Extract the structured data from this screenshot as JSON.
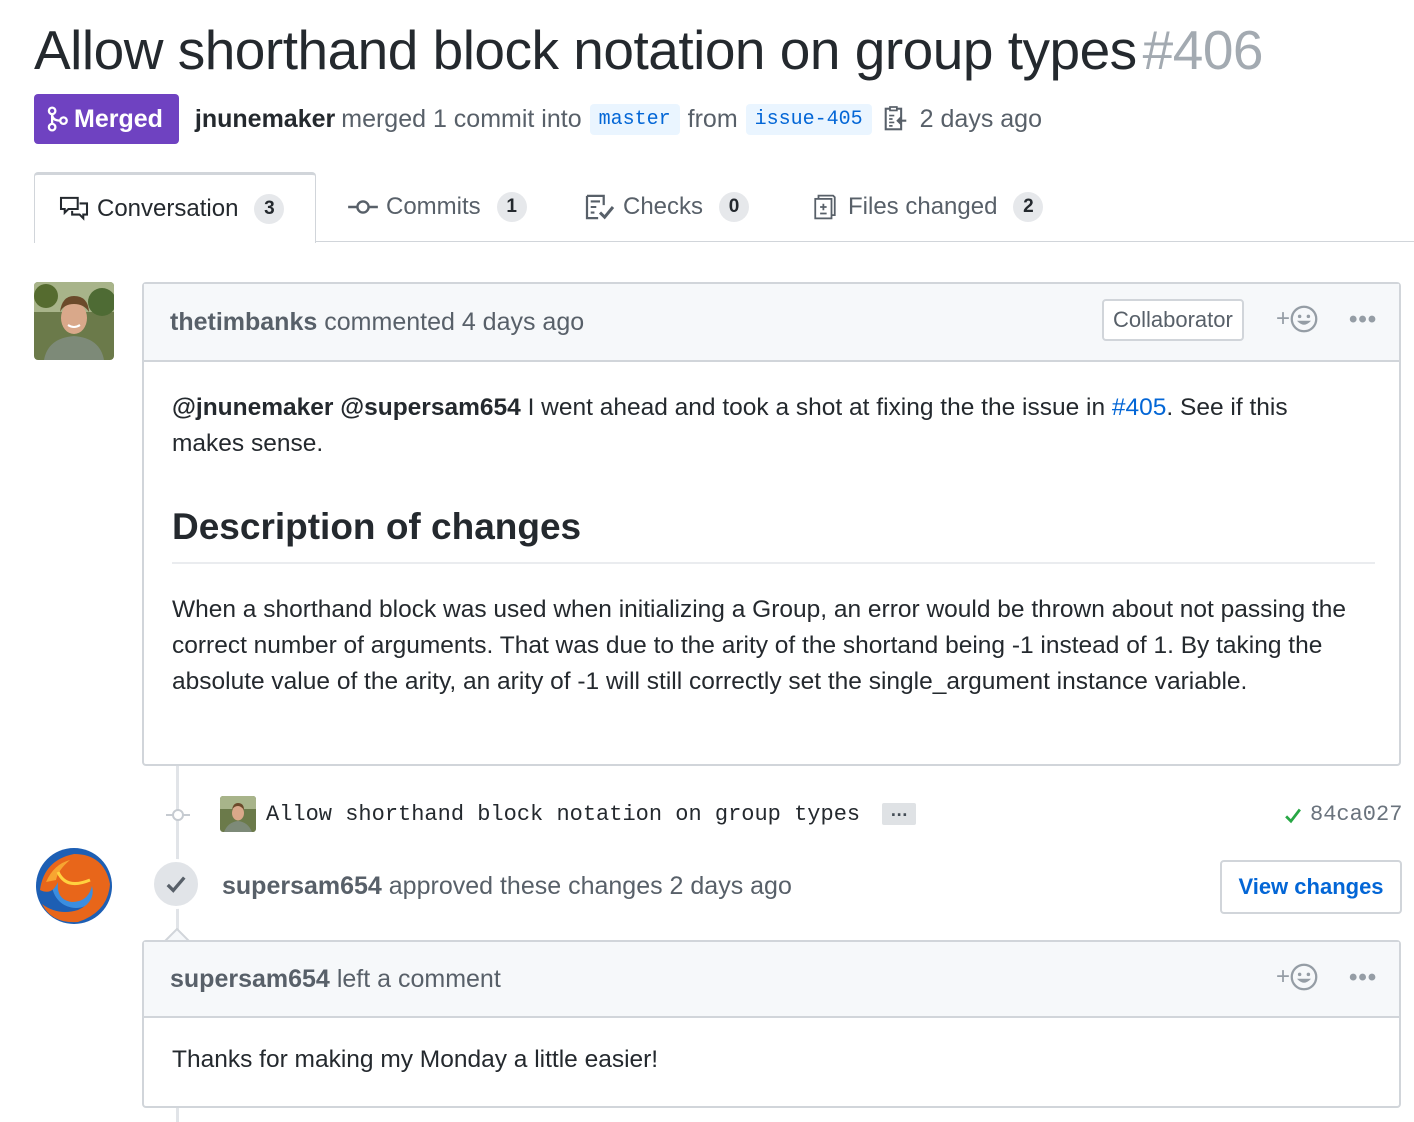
{
  "pr": {
    "title": "Allow shorthand block notation on group types",
    "number": "#406",
    "state_label": "Merged",
    "author": "jnunemaker",
    "merge_text": "merged 1 commit into",
    "base_branch": "master",
    "from_text": "from",
    "head_branch": "issue-405",
    "time_ago": "2 days ago"
  },
  "tabs": [
    {
      "label": "Conversation",
      "count": "3",
      "icon": "comment-discussion-icon"
    },
    {
      "label": "Commits",
      "count": "1",
      "icon": "git-commit-icon"
    },
    {
      "label": "Checks",
      "count": "0",
      "icon": "checklist-icon"
    },
    {
      "label": "Files changed",
      "count": "2",
      "icon": "diff-icon"
    }
  ],
  "comment1": {
    "author": "thetimbanks",
    "action": "commented 4 days ago",
    "role": "Collaborator",
    "react_plus": "+",
    "menu": "•••",
    "mention1": "@jnunemaker",
    "mention2": "@supersam654",
    "intro_text": " I went ahead and took a shot at fixing the the issue in ",
    "issue_link": "#405",
    "intro_text_end": ". See if this makes sense.",
    "heading": "Description of changes",
    "paragraph": "When a shorthand block was used when initializing a Group, an error would be thrown about not passing the correct number of arguments. That was due to the arity of the shortand being -1 instead of 1. By taking the absolute value of the arity, an arity of -1 will still correctly set the single_argument instance variable."
  },
  "commit": {
    "message": "Allow shorthand block notation on group types",
    "ellipsis": "…",
    "sha": "84ca027",
    "status_color": "#28a745"
  },
  "review": {
    "author": "supersam654",
    "action": "approved these changes 2 days ago",
    "button": "View changes"
  },
  "comment2": {
    "author": "supersam654",
    "action": "left a comment",
    "react_plus": "+",
    "menu": "•••",
    "body": "Thanks for making my Monday a little easier!"
  },
  "colors": {
    "merged": "#6f42c1",
    "link": "#0366d6",
    "branch_bg": "#eaf5ff"
  }
}
